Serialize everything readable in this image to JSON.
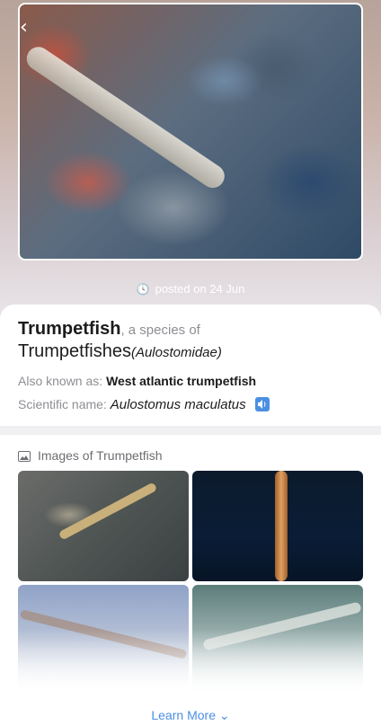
{
  "header": {
    "back_icon": "chevron-left-icon"
  },
  "post": {
    "posted_text": "posted on 24 Jun"
  },
  "species": {
    "common_name": "Trumpetfish",
    "species_of_text": ", a species of",
    "family_name": "Trumpetfishes",
    "family_scientific": "(Aulostomidae)",
    "aka_label": "Also known as:",
    "aka_value": "West atlantic trumpetfish",
    "sci_label": "Scientific name:",
    "sci_value": "Aulostomus maculatus"
  },
  "gallery": {
    "title": "Images of Trumpetfish"
  },
  "footer": {
    "learn_more": "Learn More ⌄"
  },
  "colors": {
    "accent": "#4a90e2"
  }
}
